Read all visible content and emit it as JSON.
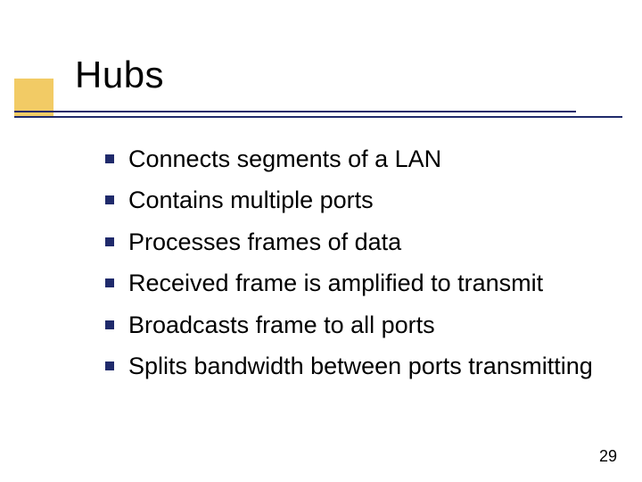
{
  "slide": {
    "title": "Hubs",
    "bullets": [
      "Connects segments of a LAN",
      "Contains multiple ports",
      "Processes frames of data",
      "Received frame is amplified to transmit",
      "Broadcasts frame to all ports",
      "Splits bandwidth between ports transmitting"
    ],
    "page_number": "29"
  }
}
